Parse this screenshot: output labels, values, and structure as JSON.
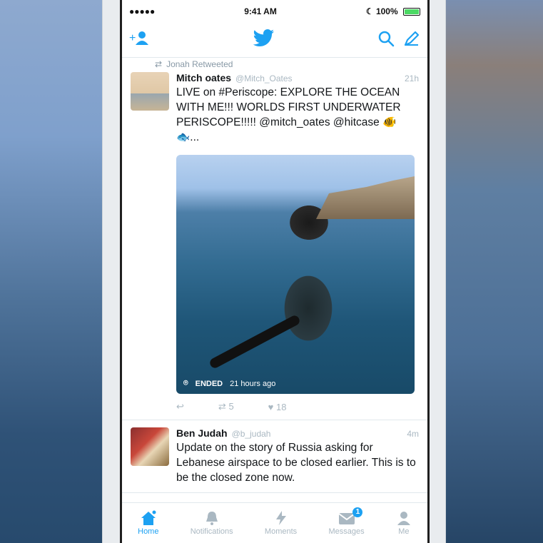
{
  "status_bar": {
    "signal": "●●●●● ",
    "time": "9:41 AM",
    "battery": "100%"
  },
  "colors": {
    "brand": "#1da1f2",
    "muted": "#aab8c2",
    "text": "#14171a"
  },
  "tweets": [
    {
      "retweeted_by": "Jonah Retweeted",
      "name": "Mitch oates",
      "handle": "@Mitch_Oates",
      "time": "21h",
      "text": "LIVE on #Periscope:  EXPLORE THE OCEAN WITH ME!!! WORLDS FIRST UNDERWATER PERISCOPE!!!!! @mitch_oates @hitcase 🐠🐟...",
      "media": {
        "status": "ENDED",
        "ago": "21 hours ago"
      },
      "actions": {
        "retweets": "5",
        "likes": "18"
      }
    },
    {
      "name": "Ben Judah",
      "handle": "@b_judah",
      "time": "4m",
      "text": "Update on the story of Russia asking for Lebanese airspace to be closed earlier. This is to be the closed zone now."
    }
  ],
  "tabs": [
    {
      "label": "Home",
      "icon": "home-icon"
    },
    {
      "label": "Notifications",
      "icon": "bell-icon"
    },
    {
      "label": "Moments",
      "icon": "lightning-icon"
    },
    {
      "label": "Messages",
      "icon": "envelope-icon",
      "badge": "1"
    },
    {
      "label": "Me",
      "icon": "person-icon"
    }
  ]
}
